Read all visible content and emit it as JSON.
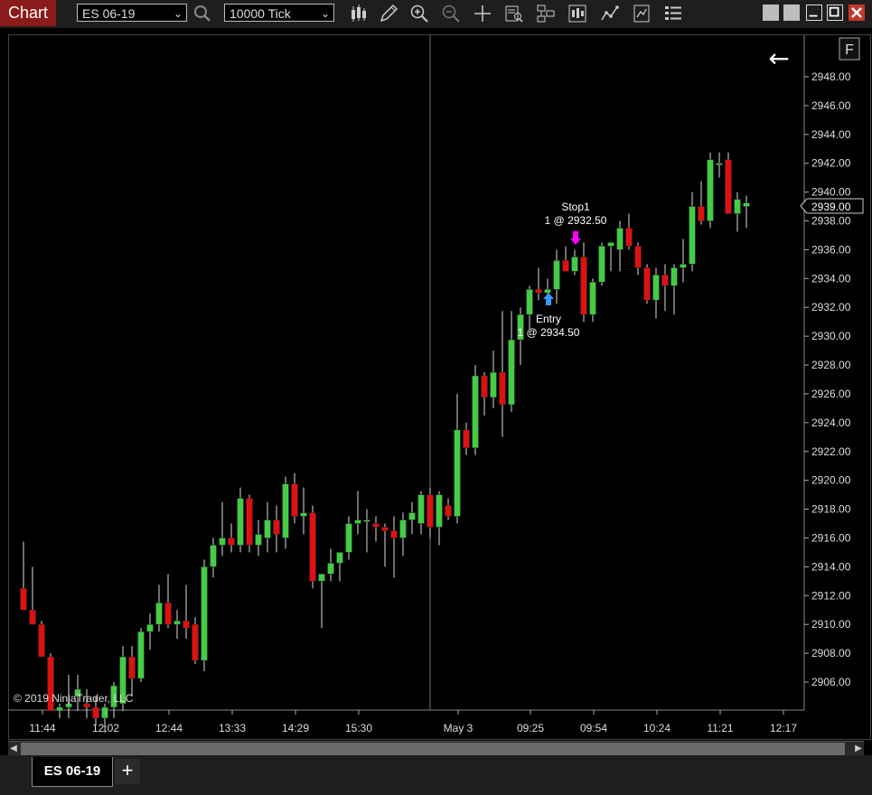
{
  "window": {
    "title": "Chart",
    "instrument": "ES 06-19",
    "interval": "10000 Tick",
    "toolbar_icons": [
      "bar-type-icon",
      "draw-pencil-icon",
      "zoom-in-icon",
      "zoom-out-icon",
      "crosshair-icon",
      "data-box-icon",
      "properties-icon",
      "show-chart-trader-icon",
      "strategy-icon",
      "indicators-icon",
      "templates-icon"
    ],
    "window_buttons": [
      "restore-gray-icon",
      "restore-gray-icon",
      "minimize-icon",
      "maximize-icon",
      "close-icon"
    ]
  },
  "chart": {
    "price_marker_label": "F",
    "copyright": "© 2019 NinjaTrader, LLC",
    "current_price_label": "2939.00",
    "back_arrow": "←",
    "executions": {
      "entry_label": "Entry",
      "entry_detail": "1 @ 2934.50",
      "stop_label": "Stop1",
      "stop_detail": "1 @ 2932.50"
    },
    "y_ticks": [
      "2948.00",
      "2946.00",
      "2944.00",
      "2942.00",
      "2940.00",
      "2938.00",
      "2936.00",
      "2934.00",
      "2932.00",
      "2930.00",
      "2928.00",
      "2926.00",
      "2924.00",
      "2922.00",
      "2920.00",
      "2918.00",
      "2916.00",
      "2914.00",
      "2912.00",
      "2910.00",
      "2908.00",
      "2906.00"
    ],
    "x_ticks": [
      "11:44",
      "12:02",
      "12:44",
      "13:33",
      "14:29",
      "15:30",
      "May 3",
      "09:25",
      "09:54",
      "10:24",
      "11:21",
      "12:17"
    ],
    "colors": {
      "up": "#44cc44",
      "down": "#dd1111",
      "wick": "#dddddd",
      "stop_marker": "#ff00ff",
      "entry_marker": "#3399ff"
    }
  },
  "chart_data": {
    "type": "candlestick",
    "ylim": [
      2904.0,
      2950.0
    ],
    "candles": [
      {
        "o": 2912.5,
        "h": 2915.75,
        "l": 2911.0,
        "c": 2911.0
      },
      {
        "o": 2911.0,
        "h": 2914.0,
        "l": 2910.0,
        "c": 2910.0
      },
      {
        "o": 2910.0,
        "h": 2910.25,
        "l": 2907.75,
        "c": 2907.75
      },
      {
        "o": 2907.75,
        "h": 2908.0,
        "l": 2904.0,
        "c": 2904.0
      },
      {
        "o": 2904.0,
        "h": 2904.5,
        "l": 2903.5,
        "c": 2904.25
      },
      {
        "o": 2904.25,
        "h": 2906.5,
        "l": 2903.5,
        "c": 2904.5
      },
      {
        "o": 2905.0,
        "h": 2906.5,
        "l": 2904.0,
        "c": 2905.5
      },
      {
        "o": 2904.5,
        "h": 2905.5,
        "l": 2903.5,
        "c": 2904.25
      },
      {
        "o": 2904.25,
        "h": 2905.0,
        "l": 2903.0,
        "c": 2903.5
      },
      {
        "o": 2903.5,
        "h": 2904.5,
        "l": 2902.5,
        "c": 2904.25
      },
      {
        "o": 2904.25,
        "h": 2906.0,
        "l": 2903.5,
        "c": 2905.75
      },
      {
        "o": 2904.5,
        "h": 2908.5,
        "l": 2904.0,
        "c": 2907.75
      },
      {
        "o": 2907.75,
        "h": 2908.5,
        "l": 2905.0,
        "c": 2906.25
      },
      {
        "o": 2906.25,
        "h": 2909.75,
        "l": 2906.0,
        "c": 2909.5
      },
      {
        "o": 2909.5,
        "h": 2910.75,
        "l": 2908.25,
        "c": 2910.0
      },
      {
        "o": 2910.0,
        "h": 2912.75,
        "l": 2909.5,
        "c": 2911.5
      },
      {
        "o": 2911.5,
        "h": 2913.5,
        "l": 2909.75,
        "c": 2910.0
      },
      {
        "o": 2910.0,
        "h": 2911.0,
        "l": 2909.0,
        "c": 2910.25
      },
      {
        "o": 2910.25,
        "h": 2912.75,
        "l": 2909.0,
        "c": 2909.75
      },
      {
        "o": 2910.0,
        "h": 2910.5,
        "l": 2907.25,
        "c": 2907.5
      },
      {
        "o": 2907.5,
        "h": 2914.5,
        "l": 2906.75,
        "c": 2914.0
      },
      {
        "o": 2914.0,
        "h": 2916.0,
        "l": 2913.25,
        "c": 2915.5
      },
      {
        "o": 2915.5,
        "h": 2918.5,
        "l": 2914.75,
        "c": 2916.0
      },
      {
        "o": 2916.0,
        "h": 2917.0,
        "l": 2915.0,
        "c": 2915.5
      },
      {
        "o": 2915.5,
        "h": 2919.5,
        "l": 2915.0,
        "c": 2918.75
      },
      {
        "o": 2918.75,
        "h": 2919.0,
        "l": 2915.0,
        "c": 2915.5
      },
      {
        "o": 2915.5,
        "h": 2917.25,
        "l": 2914.75,
        "c": 2916.25
      },
      {
        "o": 2916.0,
        "h": 2918.5,
        "l": 2915.0,
        "c": 2917.25
      },
      {
        "o": 2917.25,
        "h": 2918.25,
        "l": 2915.0,
        "c": 2916.25
      },
      {
        "o": 2916.0,
        "h": 2920.25,
        "l": 2915.25,
        "c": 2919.75
      },
      {
        "o": 2919.75,
        "h": 2920.5,
        "l": 2917.0,
        "c": 2917.5
      },
      {
        "o": 2917.5,
        "h": 2919.5,
        "l": 2916.25,
        "c": 2917.75
      },
      {
        "o": 2917.75,
        "h": 2918.25,
        "l": 2912.5,
        "c": 2913.0
      },
      {
        "o": 2913.0,
        "h": 2913.5,
        "l": 2909.75,
        "c": 2913.5
      },
      {
        "o": 2913.5,
        "h": 2915.25,
        "l": 2913.0,
        "c": 2914.25
      },
      {
        "o": 2914.25,
        "h": 2915.0,
        "l": 2913.0,
        "c": 2915.0
      },
      {
        "o": 2915.0,
        "h": 2917.5,
        "l": 2914.5,
        "c": 2917.0
      },
      {
        "o": 2917.0,
        "h": 2919.25,
        "l": 2916.25,
        "c": 2917.25
      },
      {
        "o": 2917.25,
        "h": 2918.0,
        "l": 2915.0,
        "c": 2917.25
      },
      {
        "o": 2917.0,
        "h": 2917.5,
        "l": 2915.75,
        "c": 2916.75
      },
      {
        "o": 2916.75,
        "h": 2917.0,
        "l": 2914.0,
        "c": 2916.5
      },
      {
        "o": 2916.5,
        "h": 2917.5,
        "l": 2913.25,
        "c": 2916.0
      },
      {
        "o": 2916.0,
        "h": 2917.75,
        "l": 2914.75,
        "c": 2917.25
      },
      {
        "o": 2917.25,
        "h": 2918.5,
        "l": 2916.25,
        "c": 2917.75
      },
      {
        "o": 2917.0,
        "h": 2919.25,
        "l": 2916.25,
        "c": 2919.0
      },
      {
        "o": 2919.0,
        "h": 2919.5,
        "l": 2916.0,
        "c": 2916.75
      },
      {
        "o": 2916.75,
        "h": 2919.25,
        "l": 2915.5,
        "c": 2919.0
      },
      {
        "o": 2918.25,
        "h": 2918.75,
        "l": 2917.25,
        "c": 2917.5
      },
      {
        "o": 2917.5,
        "h": 2926.0,
        "l": 2917.0,
        "c": 2923.5
      },
      {
        "o": 2923.5,
        "h": 2924.0,
        "l": 2921.75,
        "c": 2922.25
      },
      {
        "o": 2922.25,
        "h": 2928.0,
        "l": 2921.75,
        "c": 2927.25
      },
      {
        "o": 2927.25,
        "h": 2927.5,
        "l": 2924.5,
        "c": 2925.75
      },
      {
        "o": 2925.75,
        "h": 2929.0,
        "l": 2925.0,
        "c": 2927.5
      },
      {
        "o": 2927.5,
        "h": 2931.75,
        "l": 2923.0,
        "c": 2925.25
      },
      {
        "o": 2925.25,
        "h": 2931.75,
        "l": 2924.75,
        "c": 2929.75
      },
      {
        "o": 2929.75,
        "h": 2932.0,
        "l": 2928.0,
        "c": 2931.5
      },
      {
        "o": 2931.5,
        "h": 2933.5,
        "l": 2930.5,
        "c": 2933.25
      },
      {
        "o": 2933.25,
        "h": 2934.75,
        "l": 2932.5,
        "c": 2933.0
      },
      {
        "o": 2933.0,
        "h": 2934.0,
        "l": 2932.5,
        "c": 2933.25
      },
      {
        "o": 2933.25,
        "h": 2936.0,
        "l": 2932.25,
        "c": 2935.25
      },
      {
        "o": 2935.25,
        "h": 2936.25,
        "l": 2934.5,
        "c": 2934.5
      },
      {
        "o": 2934.5,
        "h": 2936.0,
        "l": 2934.25,
        "c": 2935.5
      },
      {
        "o": 2935.5,
        "h": 2936.5,
        "l": 2931.0,
        "c": 2931.5
      },
      {
        "o": 2931.5,
        "h": 2934.0,
        "l": 2931.0,
        "c": 2933.75
      },
      {
        "o": 2933.75,
        "h": 2936.5,
        "l": 2933.5,
        "c": 2936.25
      },
      {
        "o": 2936.25,
        "h": 2936.5,
        "l": 2934.5,
        "c": 2936.5
      },
      {
        "o": 2936.0,
        "h": 2938.0,
        "l": 2934.5,
        "c": 2937.5
      },
      {
        "o": 2937.5,
        "h": 2938.5,
        "l": 2936.0,
        "c": 2936.25
      },
      {
        "o": 2936.25,
        "h": 2936.5,
        "l": 2934.25,
        "c": 2934.75
      },
      {
        "o": 2934.75,
        "h": 2935.0,
        "l": 2932.25,
        "c": 2932.5
      },
      {
        "o": 2932.5,
        "h": 2934.75,
        "l": 2931.25,
        "c": 2934.25
      },
      {
        "o": 2934.25,
        "h": 2935.0,
        "l": 2931.75,
        "c": 2933.5
      },
      {
        "o": 2933.5,
        "h": 2935.0,
        "l": 2931.5,
        "c": 2934.75
      },
      {
        "o": 2934.75,
        "h": 2936.75,
        "l": 2933.75,
        "c": 2935.0
      },
      {
        "o": 2935.0,
        "h": 2940.0,
        "l": 2934.5,
        "c": 2939.0
      },
      {
        "o": 2939.0,
        "h": 2940.75,
        "l": 2937.75,
        "c": 2938.0
      },
      {
        "o": 2938.0,
        "h": 2942.75,
        "l": 2937.5,
        "c": 2942.25
      },
      {
        "o": 2942.0,
        "h": 2942.75,
        "l": 2941.0,
        "c": 2942.0
      },
      {
        "o": 2942.25,
        "h": 2942.75,
        "l": 2938.5,
        "c": 2938.5
      },
      {
        "o": 2938.5,
        "h": 2940.0,
        "l": 2937.25,
        "c": 2939.5
      },
      {
        "o": 2939.0,
        "h": 2939.75,
        "l": 2937.5,
        "c": 2939.25
      }
    ],
    "executions": [
      {
        "type": "entry",
        "side": "buy",
        "price": 2934.5,
        "candle": 58
      },
      {
        "type": "stop",
        "side": "sell",
        "price": 2932.5,
        "candle": 62
      }
    ]
  }
}
